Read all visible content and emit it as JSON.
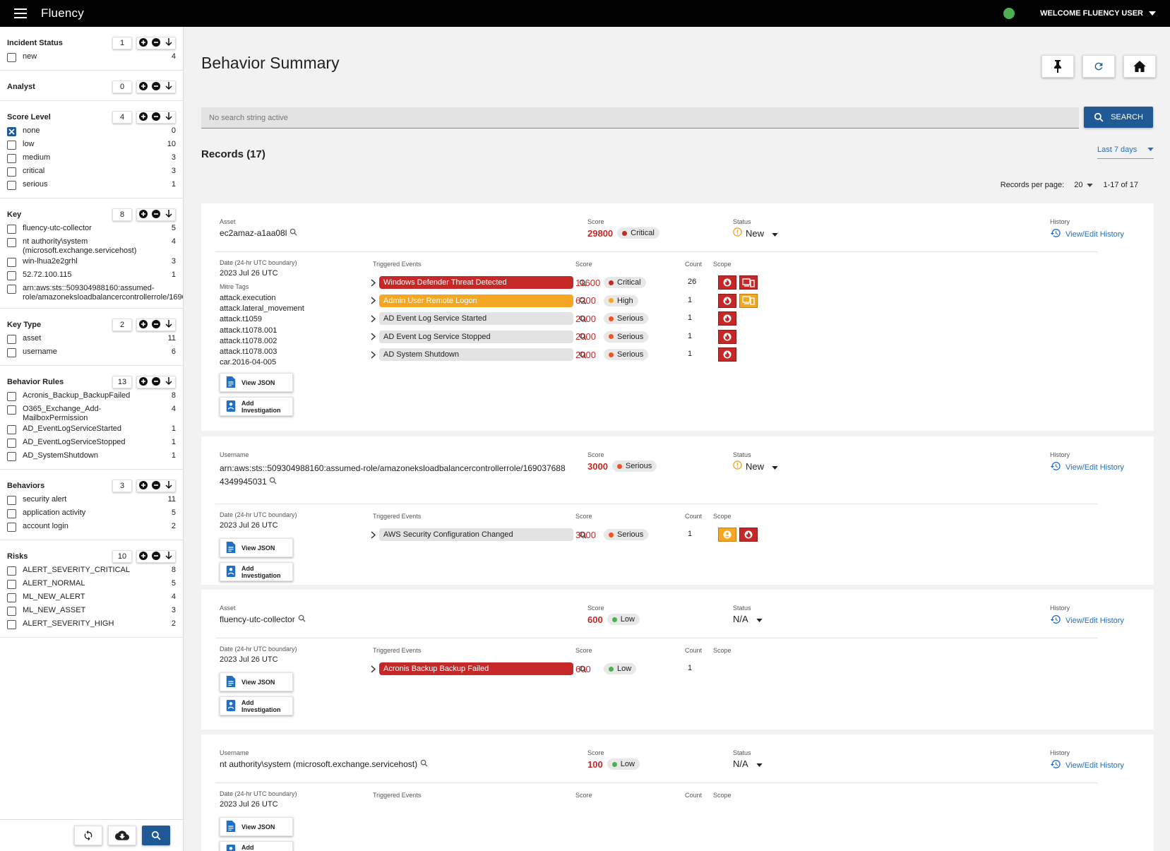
{
  "app": {
    "title": "Fluency",
    "welcome": "WELCOME FLUENCY USER"
  },
  "colors": {
    "brand_blue": "#1f5a96",
    "score_red": "#c62828",
    "critical": "#c62828",
    "high": "#f5a623",
    "serious": "#f4511e",
    "low": "#4caf50",
    "topbar": "#000000",
    "status_ok": "#4caf50"
  },
  "sidebar": {
    "groups": [
      {
        "title": "Incident Status",
        "count": "1",
        "items": [
          {
            "label": "new",
            "count": "4",
            "checked": false
          }
        ]
      },
      {
        "title": "Analyst",
        "count": "0",
        "items": []
      },
      {
        "title": "Score Level",
        "count": "4",
        "items": [
          {
            "label": "none",
            "count": "0",
            "checked": true
          },
          {
            "label": "low",
            "count": "10",
            "checked": false
          },
          {
            "label": "medium",
            "count": "3",
            "checked": false
          },
          {
            "label": "critical",
            "count": "3",
            "checked": false
          },
          {
            "label": "serious",
            "count": "1",
            "checked": false
          }
        ]
      },
      {
        "title": "Key",
        "count": "8",
        "items": [
          {
            "label": "fluency-utc-collector",
            "count": "5",
            "checked": false
          },
          {
            "label": "nt authority\\system (microsoft.exchange.servicehost)",
            "count": "4",
            "checked": false
          },
          {
            "label": "win-lhua2e2grhl",
            "count": "3",
            "checked": false
          },
          {
            "label": "52.72.100.115",
            "count": "1",
            "checked": false
          },
          {
            "label": "arn:aws:sts::509304988160:assumed-role/amazoneksloadbalancercontrollerrole/1690376884349945031",
            "count": "1",
            "checked": false
          }
        ]
      },
      {
        "title": "Key Type",
        "count": "2",
        "items": [
          {
            "label": "asset",
            "count": "11",
            "checked": false
          },
          {
            "label": "username",
            "count": "6",
            "checked": false
          }
        ]
      },
      {
        "title": "Behavior Rules",
        "count": "13",
        "items": [
          {
            "label": "Acronis_Backup_BackupFailed",
            "count": "8",
            "checked": false
          },
          {
            "label": "O365_Exchange_Add-MailboxPermission",
            "count": "4",
            "checked": false
          },
          {
            "label": "AD_EventLogServiceStarted",
            "count": "1",
            "checked": false
          },
          {
            "label": "AD_EventLogServiceStopped",
            "count": "1",
            "checked": false
          },
          {
            "label": "AD_SystemShutdown",
            "count": "1",
            "checked": false
          }
        ]
      },
      {
        "title": "Behaviors",
        "count": "3",
        "items": [
          {
            "label": "security alert",
            "count": "11",
            "checked": false
          },
          {
            "label": "application activity",
            "count": "5",
            "checked": false
          },
          {
            "label": "account login",
            "count": "2",
            "checked": false
          }
        ]
      },
      {
        "title": "Risks",
        "count": "10",
        "items": [
          {
            "label": "ALERT_SEVERITY_CRITICAL",
            "count": "8",
            "checked": false
          },
          {
            "label": "ALERT_NORMAL",
            "count": "5",
            "checked": false
          },
          {
            "label": "ML_NEW_ALERT",
            "count": "4",
            "checked": false
          },
          {
            "label": "ML_NEW_ASSET",
            "count": "3",
            "checked": false
          },
          {
            "label": "ALERT_SEVERITY_HIGH",
            "count": "2",
            "checked": false
          }
        ]
      }
    ]
  },
  "main": {
    "title": "Behavior Summary",
    "search_placeholder": "No search string active",
    "search_label": "SEARCH",
    "records_title": "Records (17)",
    "range": "Last 7 days",
    "per_page_label": "Records per page:",
    "per_page": "20",
    "page_range": "1-17 of 17"
  },
  "labels": {
    "score": "Score",
    "status": "Status",
    "history": "History",
    "view_history": "View/Edit History",
    "date": "Date (24-hr UTC boundary)",
    "triggered": "Triggered Events",
    "count": "Count",
    "scope": "Scope",
    "mitre": "Mitre Tags",
    "view_json": "View JSON",
    "add_investigation": "Add Investigation"
  },
  "records": [
    {
      "key_label": "Asset",
      "key": "ec2amaz-a1aa08l",
      "score": "29800",
      "level": "Critical",
      "status": "New",
      "status_warn": true,
      "date": "2023 Jul 26 UTC",
      "mitre": [
        "attack.execution",
        "attack.lateral_movement",
        "attack.t1059",
        "attack.t1078.001",
        "attack.t1078.002",
        "attack.t1078.003",
        "car.2016-04-005"
      ],
      "events": [
        {
          "name": "Windows Defender Threat Detected",
          "style": "critical",
          "score": "11600",
          "level": "Critical",
          "count": "26",
          "scope": [
            "fire-red",
            "device-red"
          ]
        },
        {
          "name": "Admin User Remote Logon",
          "style": "high",
          "score": "6200",
          "level": "High",
          "count": "1",
          "scope": [
            "fire-red",
            "device-orange"
          ]
        },
        {
          "name": "AD Event Log Service Started",
          "style": "plain",
          "score": "2000",
          "level": "Serious",
          "count": "1",
          "scope": [
            "fire-red"
          ]
        },
        {
          "name": "AD Event Log Service Stopped",
          "style": "plain",
          "score": "2000",
          "level": "Serious",
          "count": "1",
          "scope": [
            "fire-red"
          ]
        },
        {
          "name": "AD System Shutdown",
          "style": "plain",
          "score": "2000",
          "level": "Serious",
          "count": "1",
          "scope": [
            "fire-red"
          ]
        }
      ]
    },
    {
      "key_label": "Username",
      "key": "arn:aws:sts::509304988160:assumed-role/amazoneksloadbalancercontrollerrole/1690376884349945031",
      "score": "3000",
      "level": "Serious",
      "status": "New",
      "status_warn": true,
      "date": "2023 Jul 26 UTC",
      "mitre": [],
      "events": [
        {
          "name": "AWS Security Configuration Changed",
          "style": "plain",
          "score": "3000",
          "level": "Serious",
          "count": "1",
          "scope": [
            "user-orange",
            "fire-red"
          ]
        }
      ]
    },
    {
      "key_label": "Asset",
      "key": "fluency-utc-collector",
      "score": "600",
      "level": "Low",
      "status": "N/A",
      "status_warn": false,
      "date": "2023 Jul 26 UTC",
      "mitre": [],
      "events": [
        {
          "name": "Acronis Backup Backup Failed",
          "style": "critical",
          "score": "600",
          "level": "Low",
          "count": "1",
          "scope": []
        }
      ]
    },
    {
      "key_label": "Username",
      "key": "nt authority\\system (microsoft.exchange.servicehost)",
      "score": "100",
      "level": "Low",
      "status": "N/A",
      "status_warn": false,
      "date": "2023 Jul 26 UTC",
      "mitre": [],
      "events": []
    }
  ]
}
